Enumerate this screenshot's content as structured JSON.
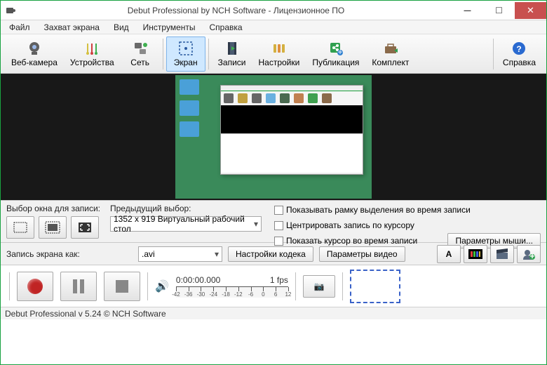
{
  "title": "Debut Professional by NCH Software - Лицензионное ПО",
  "menu": [
    "Файл",
    "Захват экрана",
    "Вид",
    "Инструменты",
    "Справка"
  ],
  "toolbar": [
    {
      "id": "webcam",
      "label": "Веб-камера"
    },
    {
      "id": "devices",
      "label": "Устройства"
    },
    {
      "id": "network",
      "label": "Сеть"
    },
    {
      "id": "screen",
      "label": "Экран",
      "selected": true
    },
    {
      "id": "recordings",
      "label": "Записи"
    },
    {
      "id": "settings",
      "label": "Настройки"
    },
    {
      "id": "publish",
      "label": "Публикация"
    },
    {
      "id": "kit",
      "label": "Комплект"
    }
  ],
  "toolbar_help": "Справка",
  "selection": {
    "window_label": "Выбор окна для записи:",
    "prev_label": "Предыдущий выбор:",
    "prev_value": "1352 x 919 Виртуальный рабочий стол",
    "checks": [
      "Показывать рамку выделения во время записи",
      "Центрировать запись по курсору",
      "Показать курсор во время записи"
    ],
    "mouse_button": "Параметры мыши..."
  },
  "format": {
    "label": "Запись экрана как:",
    "value": ".avi",
    "codec_btn": "Настройки кодека",
    "video_btn": "Параметры видео"
  },
  "playback": {
    "time": "0:00:00.000",
    "fps": "1 fps",
    "ticks": [
      -42,
      -36,
      -30,
      -24,
      -18,
      -12,
      -6,
      0,
      6,
      12
    ]
  },
  "status": "Debut Professional v 5.24 © NCH Software"
}
